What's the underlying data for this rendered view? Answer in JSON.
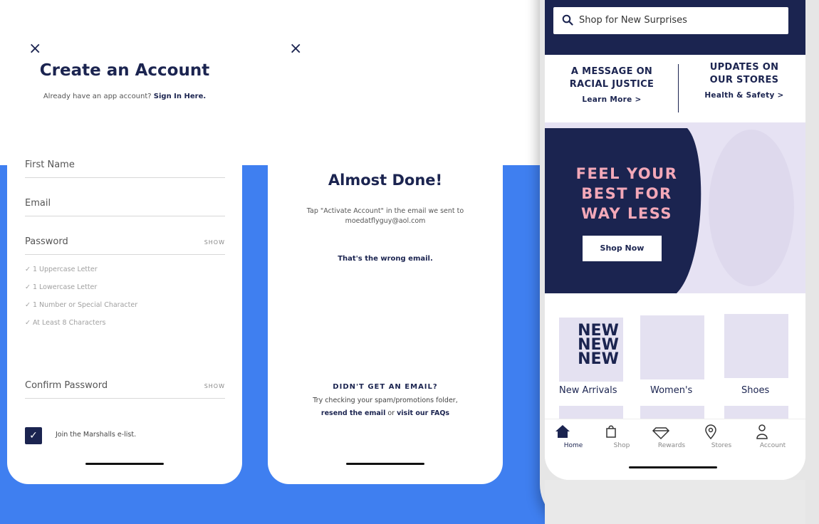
{
  "left_screen": {
    "close_icon": "×",
    "title": "Create an Account",
    "subtitle_prefix": "Already have an app account?",
    "subtitle_link": "Sign In Here.",
    "fields": {
      "first_name": "First Name",
      "email": "Email",
      "password": "Password",
      "confirm_password": "Confirm Password"
    },
    "show_label": "SHOW",
    "requirements": [
      "1 Uppercase Letter",
      "1 Lowercase Letter",
      "1 Number or Special Character",
      "At Least 8 Characters"
    ],
    "elist_label": "Join the Marshalls e-list.",
    "elist_checked": true
  },
  "middle_screen": {
    "close_icon": "×",
    "title": "Almost Done!",
    "instruction_line1": "Tap \"Activate Account\" in the email we sent to",
    "instruction_line2": "moedatflyguy@aol.com",
    "wrong_email_link": "That's the wrong email.",
    "no_email_heading": "DIDN'T GET AN EMAIL?",
    "no_email_text": "Try checking your spam/promotions folder,",
    "resend_link": "resend the email",
    "or_text": "or",
    "faq_link": "visit our FAQs"
  },
  "phone_screen": {
    "search_placeholder": "Shop for New Surprises",
    "message_left": {
      "line1": "A MESSAGE ON",
      "line2": "RACIAL JUSTICE",
      "link": "Learn More >"
    },
    "message_right": {
      "line1": "UPDATES ON",
      "line2": "OUR STORES",
      "link": "Health & Safety >"
    },
    "promo": {
      "line1": "FEEL YOUR",
      "line2": "BEST FOR",
      "line3": "WAY LESS",
      "button": "Shop Now"
    },
    "categories": [
      {
        "label": "New Arrivals",
        "tile_text": [
          "NEW",
          "NEW",
          "NEW"
        ]
      },
      {
        "label": "Women's"
      },
      {
        "label": "Shoes"
      }
    ],
    "tabs": [
      {
        "label": "Home",
        "icon": "home-icon",
        "active": true
      },
      {
        "label": "Shop",
        "icon": "shopping-bag-icon",
        "active": false
      },
      {
        "label": "Rewards",
        "icon": "diamond-icon",
        "active": false
      },
      {
        "label": "Stores",
        "icon": "location-pin-icon",
        "active": false
      },
      {
        "label": "Account",
        "icon": "person-icon",
        "active": false
      }
    ]
  },
  "colors": {
    "navy": "#1b2450",
    "blue_band": "#3f7ff0",
    "promo_pink": "#f3a8b8",
    "promo_lavender": "#e6e2f3"
  }
}
